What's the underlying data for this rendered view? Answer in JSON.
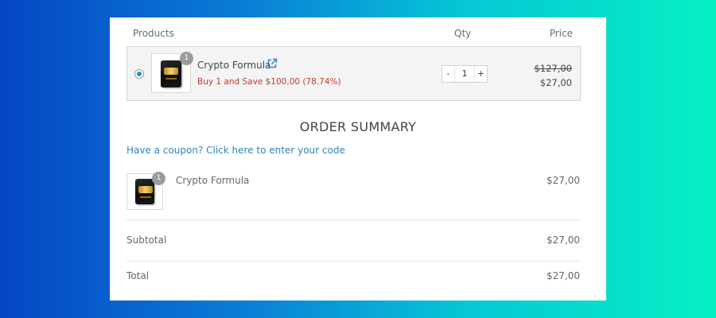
{
  "table": {
    "headers": {
      "products": "Products",
      "qty": "Qty",
      "price": "Price"
    }
  },
  "product": {
    "badge": "1",
    "name": "Crypto Formula",
    "save_text": "Buy 1 and Save $100,00 (78.74%)",
    "qty": "1",
    "minus": "-",
    "plus": "+",
    "old_price": "$127,00",
    "new_price": "$27,00",
    "selected": true,
    "icons": {
      "thumbnail": "product-box-icon",
      "link": "external-link-icon"
    }
  },
  "summary": {
    "title": "ORDER SUMMARY",
    "coupon_link": "Have a coupon? Click here to enter your code",
    "item": {
      "badge": "1",
      "name": "Crypto Formula",
      "price": "$27,00"
    },
    "subtotal": {
      "label": "Subtotal",
      "value": "$27,00"
    },
    "total": {
      "label": "Total",
      "value": "$27,00"
    }
  },
  "colors": {
    "accent_link": "#2f86b6",
    "save_text": "#c0392b",
    "radio": "#2a8fd0"
  }
}
